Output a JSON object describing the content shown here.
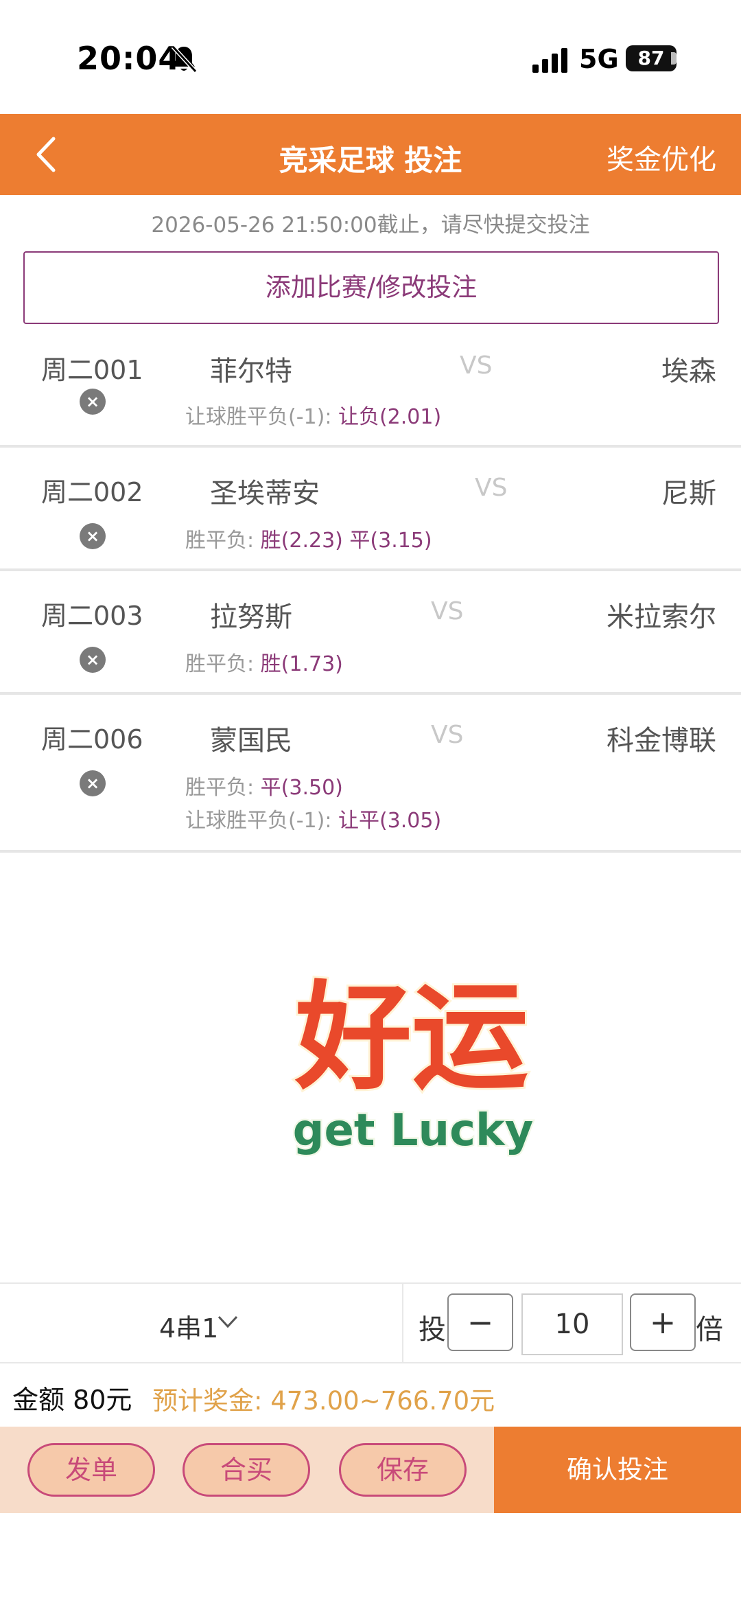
{
  "status": {
    "time": "20:04",
    "network": "5G",
    "battery": "87"
  },
  "nav": {
    "title": "竞采足球 投注",
    "right": "奖金优化"
  },
  "deadline": "2026-05-26 21:50:00截止，请尽快提交投注",
  "add_button": "添加比赛/修改投注",
  "vs_label": "VS",
  "delete_glyph": "×",
  "matches": [
    {
      "id": "周二001",
      "home": "菲尔特",
      "away": "埃森",
      "bets": [
        {
          "type": "让球胜平负(-1): ",
          "picks": "让负(2.01)"
        }
      ]
    },
    {
      "id": "周二002",
      "home": "圣埃蒂安",
      "away": "尼斯",
      "bets": [
        {
          "type": "胜平负: ",
          "picks": "胜(2.23) 平(3.15)"
        }
      ]
    },
    {
      "id": "周二003",
      "home": "拉努斯",
      "away": "米拉索尔",
      "bets": [
        {
          "type": "胜平负: ",
          "picks": "胜(1.73)"
        }
      ]
    },
    {
      "id": "周二006",
      "home": "蒙国民",
      "away": "科金博联",
      "bets": [
        {
          "type": "胜平负: ",
          "picks": "平(3.50)"
        },
        {
          "type": "让球胜平负(-1): ",
          "picks": "让平(3.05)"
        }
      ]
    }
  ],
  "logo": {
    "cn": "好运",
    "en": "get Lucky"
  },
  "controls": {
    "pass_type": "4串1",
    "tou": "投",
    "minus": "−",
    "multiplier": "10",
    "plus": "+",
    "bei": "倍"
  },
  "summary": {
    "amount": "金额 80元",
    "prize": "预计奖金: 473.00~766.70元"
  },
  "actions": {
    "post": "发单",
    "group_buy": "合买",
    "save": "保存",
    "confirm": "确认投注"
  },
  "colors": {
    "brand_orange": "#ed7d31",
    "accent_purple": "#8b3a78",
    "pill_pink": "#c84a79",
    "prize_gold": "#e0a24a"
  }
}
